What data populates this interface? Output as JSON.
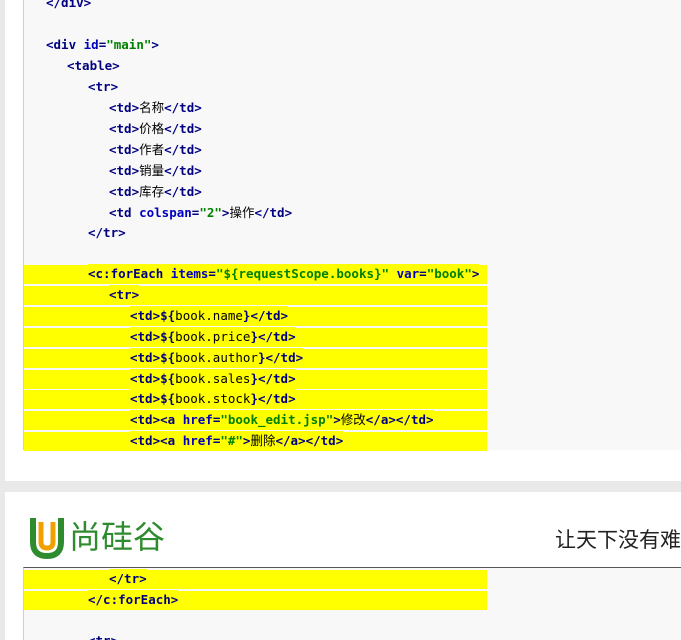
{
  "page1_lines": [
    "</div>",
    "<div id=\"main\">",
    "<table>",
    "<tr>",
    "<td>名称</td>",
    "<td>价格</td>",
    "<td>作者</td>",
    "<td>销量</td>",
    "<td>库存</td>",
    "<td colspan=\"2\">操作</td>",
    "</tr>",
    "<c:forEach items=\"${requestScope.books}\" var=\"book\">",
    "<tr>",
    "<td>${book.name}</td>",
    "<td>${book.price}</td>",
    "<td>${book.author}</td>",
    "<td>${book.sales}</td>",
    "<td>${book.stock}</td>",
    "<td><a href=\"book_edit.jsp\">修改</a></td>",
    "<td><a href=\"#\">删除</a></td>"
  ],
  "page2_lines": [
    "</tr>",
    "</c:forEach>",
    "<tr>"
  ],
  "header": {
    "logo_text": "尚硅谷",
    "slogan": "让天下没有难"
  },
  "colors": {
    "highlight": "#ffff00",
    "tag": "#000080",
    "attribute": "#0000c0",
    "value": "#008000"
  }
}
